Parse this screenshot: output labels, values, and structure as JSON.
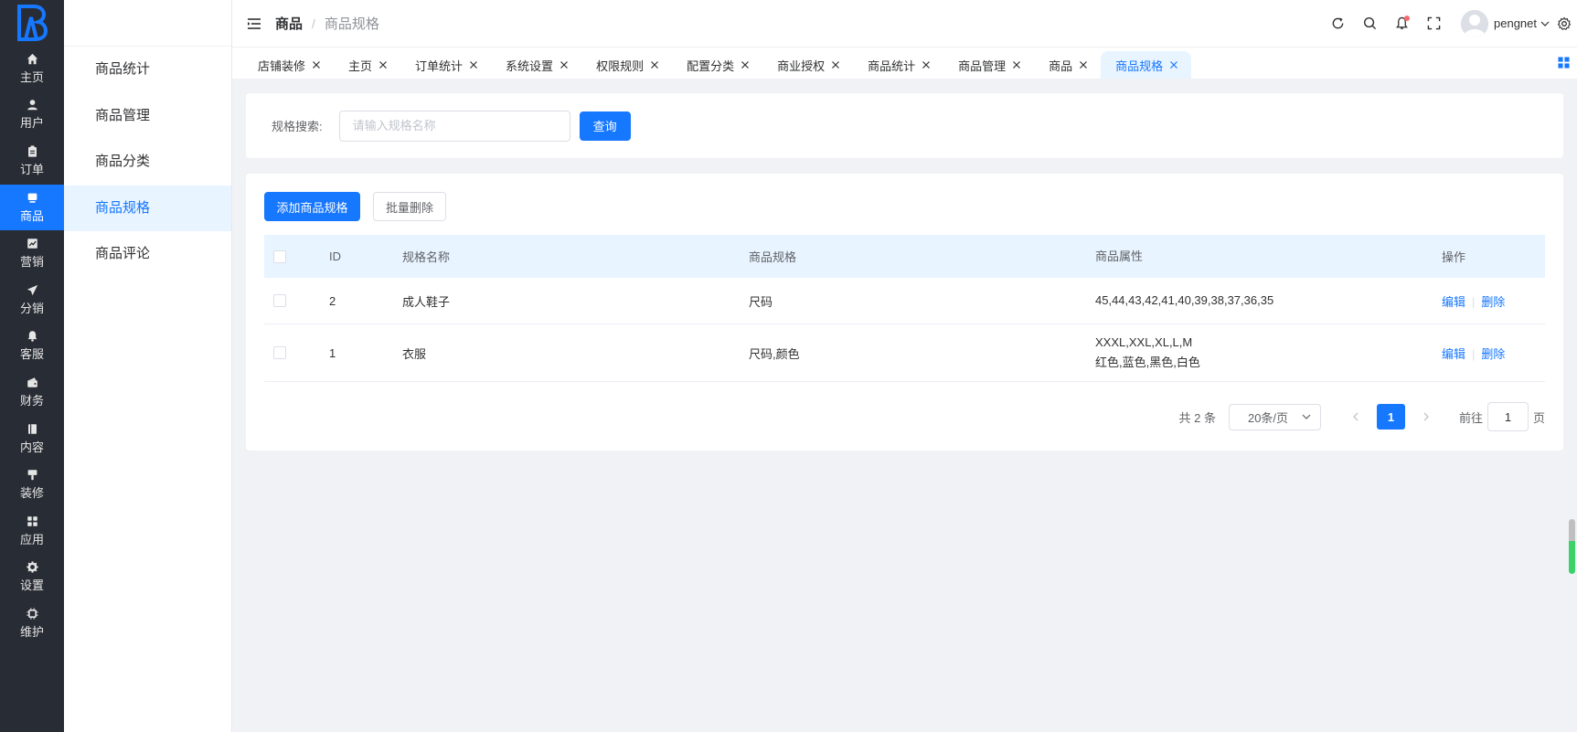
{
  "rail": {
    "items": [
      {
        "label": "主页",
        "icon": "home-icon"
      },
      {
        "label": "用户",
        "icon": "user-icon"
      },
      {
        "label": "订单",
        "icon": "clipboard-icon"
      },
      {
        "label": "商品",
        "icon": "product-icon",
        "active": true
      },
      {
        "label": "营销",
        "icon": "chart-icon"
      },
      {
        "label": "分销",
        "icon": "send-icon"
      },
      {
        "label": "客服",
        "icon": "bell-icon"
      },
      {
        "label": "财务",
        "icon": "wallet-icon"
      },
      {
        "label": "内容",
        "icon": "book-icon"
      },
      {
        "label": "装修",
        "icon": "brush-icon"
      },
      {
        "label": "应用",
        "icon": "grid-icon"
      },
      {
        "label": "设置",
        "icon": "gear-icon"
      },
      {
        "label": "维护",
        "icon": "chip-icon"
      }
    ]
  },
  "submenu": {
    "items": [
      {
        "label": "商品统计"
      },
      {
        "label": "商品管理"
      },
      {
        "label": "商品分类"
      },
      {
        "label": "商品规格",
        "active": true
      },
      {
        "label": "商品评论"
      }
    ]
  },
  "header": {
    "breadcrumb_current": "商品",
    "breadcrumb_sep": "/",
    "breadcrumb_child": "商品规格",
    "username": "pengnet"
  },
  "tabs": [
    {
      "label": "店铺装修"
    },
    {
      "label": "主页"
    },
    {
      "label": "订单统计"
    },
    {
      "label": "系统设置"
    },
    {
      "label": "权限规则"
    },
    {
      "label": "配置分类"
    },
    {
      "label": "商业授权"
    },
    {
      "label": "商品统计"
    },
    {
      "label": "商品管理"
    },
    {
      "label": "商品"
    },
    {
      "label": "商品规格",
      "active": true
    }
  ],
  "search": {
    "label": "规格搜索:",
    "placeholder": "请输入规格名称",
    "value": "",
    "button": "查询"
  },
  "toolbar": {
    "add_label": "添加商品规格",
    "batch_delete_label": "批量删除"
  },
  "table": {
    "columns": [
      "ID",
      "规格名称",
      "商品规格",
      "商品属性",
      "操作"
    ],
    "rows": [
      {
        "id": "2",
        "name": "成人鞋子",
        "spec": "尺码",
        "attr_lines": [
          "45,44,43,42,41,40,39,38,37,36,35"
        ],
        "edit": "编辑",
        "delete": "删除"
      },
      {
        "id": "1",
        "name": "衣服",
        "spec": "尺码,颜色",
        "attr_lines": [
          "XXXL,XXL,XL,L,M",
          "红色,蓝色,黑色,白色"
        ],
        "edit": "编辑",
        "delete": "删除"
      }
    ],
    "op_separator": "|"
  },
  "pagination": {
    "total_text": "共 2 条",
    "page_size": "20条/页",
    "current_page": "1",
    "goto_label": "前往",
    "goto_value": "1",
    "page_suffix": "页"
  },
  "colors": {
    "primary": "#1677ff",
    "rail_bg": "#282c34",
    "active_bg": "#e8f4ff",
    "page_bg": "#f0f2f5"
  }
}
